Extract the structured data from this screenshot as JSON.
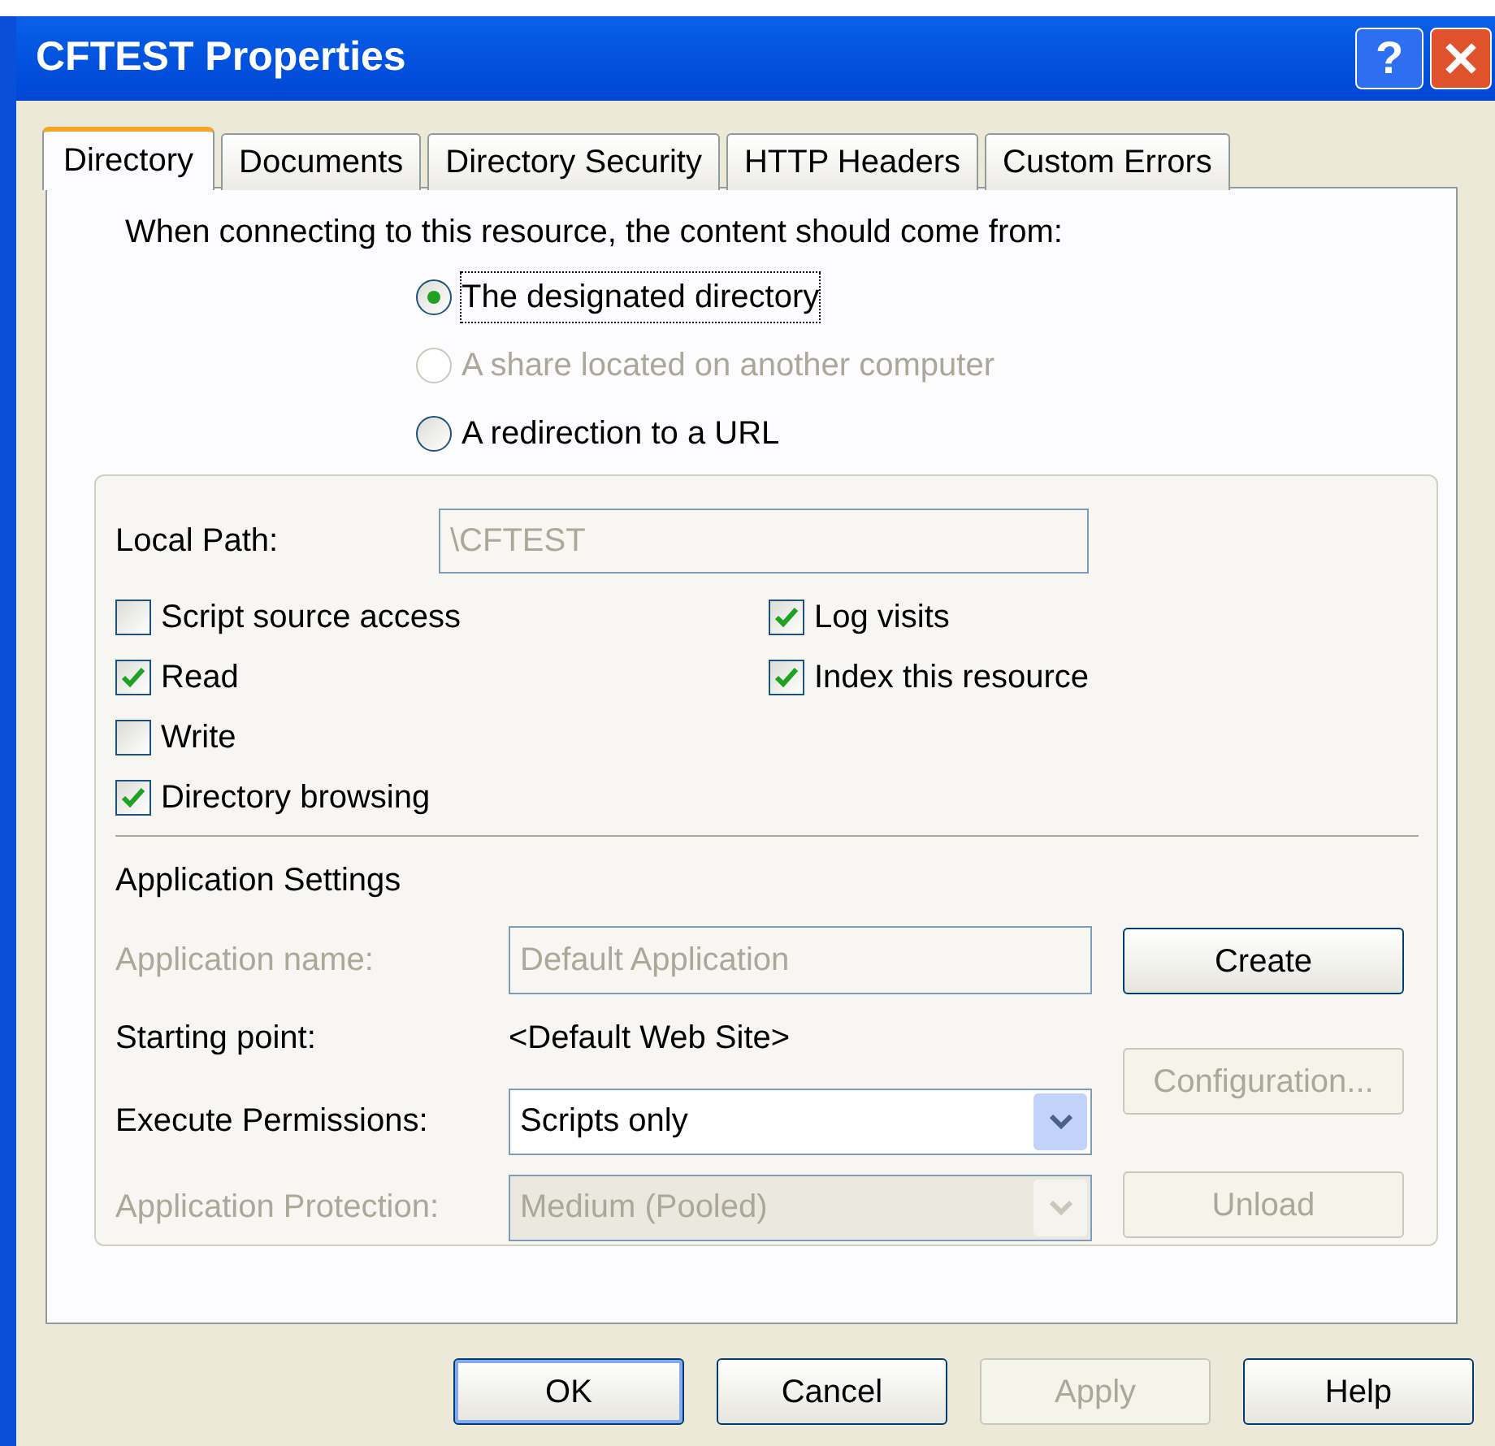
{
  "window": {
    "title": "CFTEST Properties",
    "help_glyph": "?"
  },
  "tabs": [
    {
      "label": "Directory",
      "selected": true
    },
    {
      "label": "Documents",
      "selected": false
    },
    {
      "label": "Directory Security",
      "selected": false
    },
    {
      "label": "HTTP Headers",
      "selected": false
    },
    {
      "label": "Custom Errors",
      "selected": false
    }
  ],
  "source": {
    "prompt": "When connecting to this resource, the content should come from:",
    "options": [
      {
        "label": "The designated directory",
        "selected": true,
        "disabled": false
      },
      {
        "label": "A share located on another computer",
        "selected": false,
        "disabled": true
      },
      {
        "label": "A redirection to a URL",
        "selected": false,
        "disabled": false
      }
    ]
  },
  "local_path": {
    "label": "Local Path:",
    "value": "\\CFTEST",
    "disabled": true
  },
  "permissions_left": [
    {
      "label": "Script source access",
      "checked": false
    },
    {
      "label": "Read",
      "checked": true
    },
    {
      "label": "Write",
      "checked": false
    },
    {
      "label": "Directory browsing",
      "checked": true
    }
  ],
  "permissions_right": [
    {
      "label": "Log visits",
      "checked": true
    },
    {
      "label": "Index this resource",
      "checked": true
    }
  ],
  "application_settings": {
    "heading": "Application Settings",
    "rows": [
      {
        "kind": "field",
        "label": "Application name:",
        "value": "Default Application",
        "disabled": true
      },
      {
        "kind": "text",
        "label": "Starting point:",
        "value": "<Default Web Site>",
        "disabled": false
      },
      {
        "kind": "select",
        "label": "Execute Permissions:",
        "value": "Scripts only",
        "disabled": false
      },
      {
        "kind": "select",
        "label": "Application Protection:",
        "value": "Medium (Pooled)",
        "disabled": true
      }
    ],
    "buttons": [
      {
        "label": "Create",
        "disabled": false
      },
      {
        "label": "Configuration...",
        "disabled": true
      },
      {
        "label": "Unload",
        "disabled": true
      }
    ]
  },
  "footer_buttons": [
    {
      "label": "OK",
      "disabled": false,
      "default": true
    },
    {
      "label": "Cancel",
      "disabled": false,
      "default": false
    },
    {
      "label": "Apply",
      "disabled": true,
      "default": false
    },
    {
      "label": "Help",
      "disabled": false,
      "default": false
    }
  ]
}
